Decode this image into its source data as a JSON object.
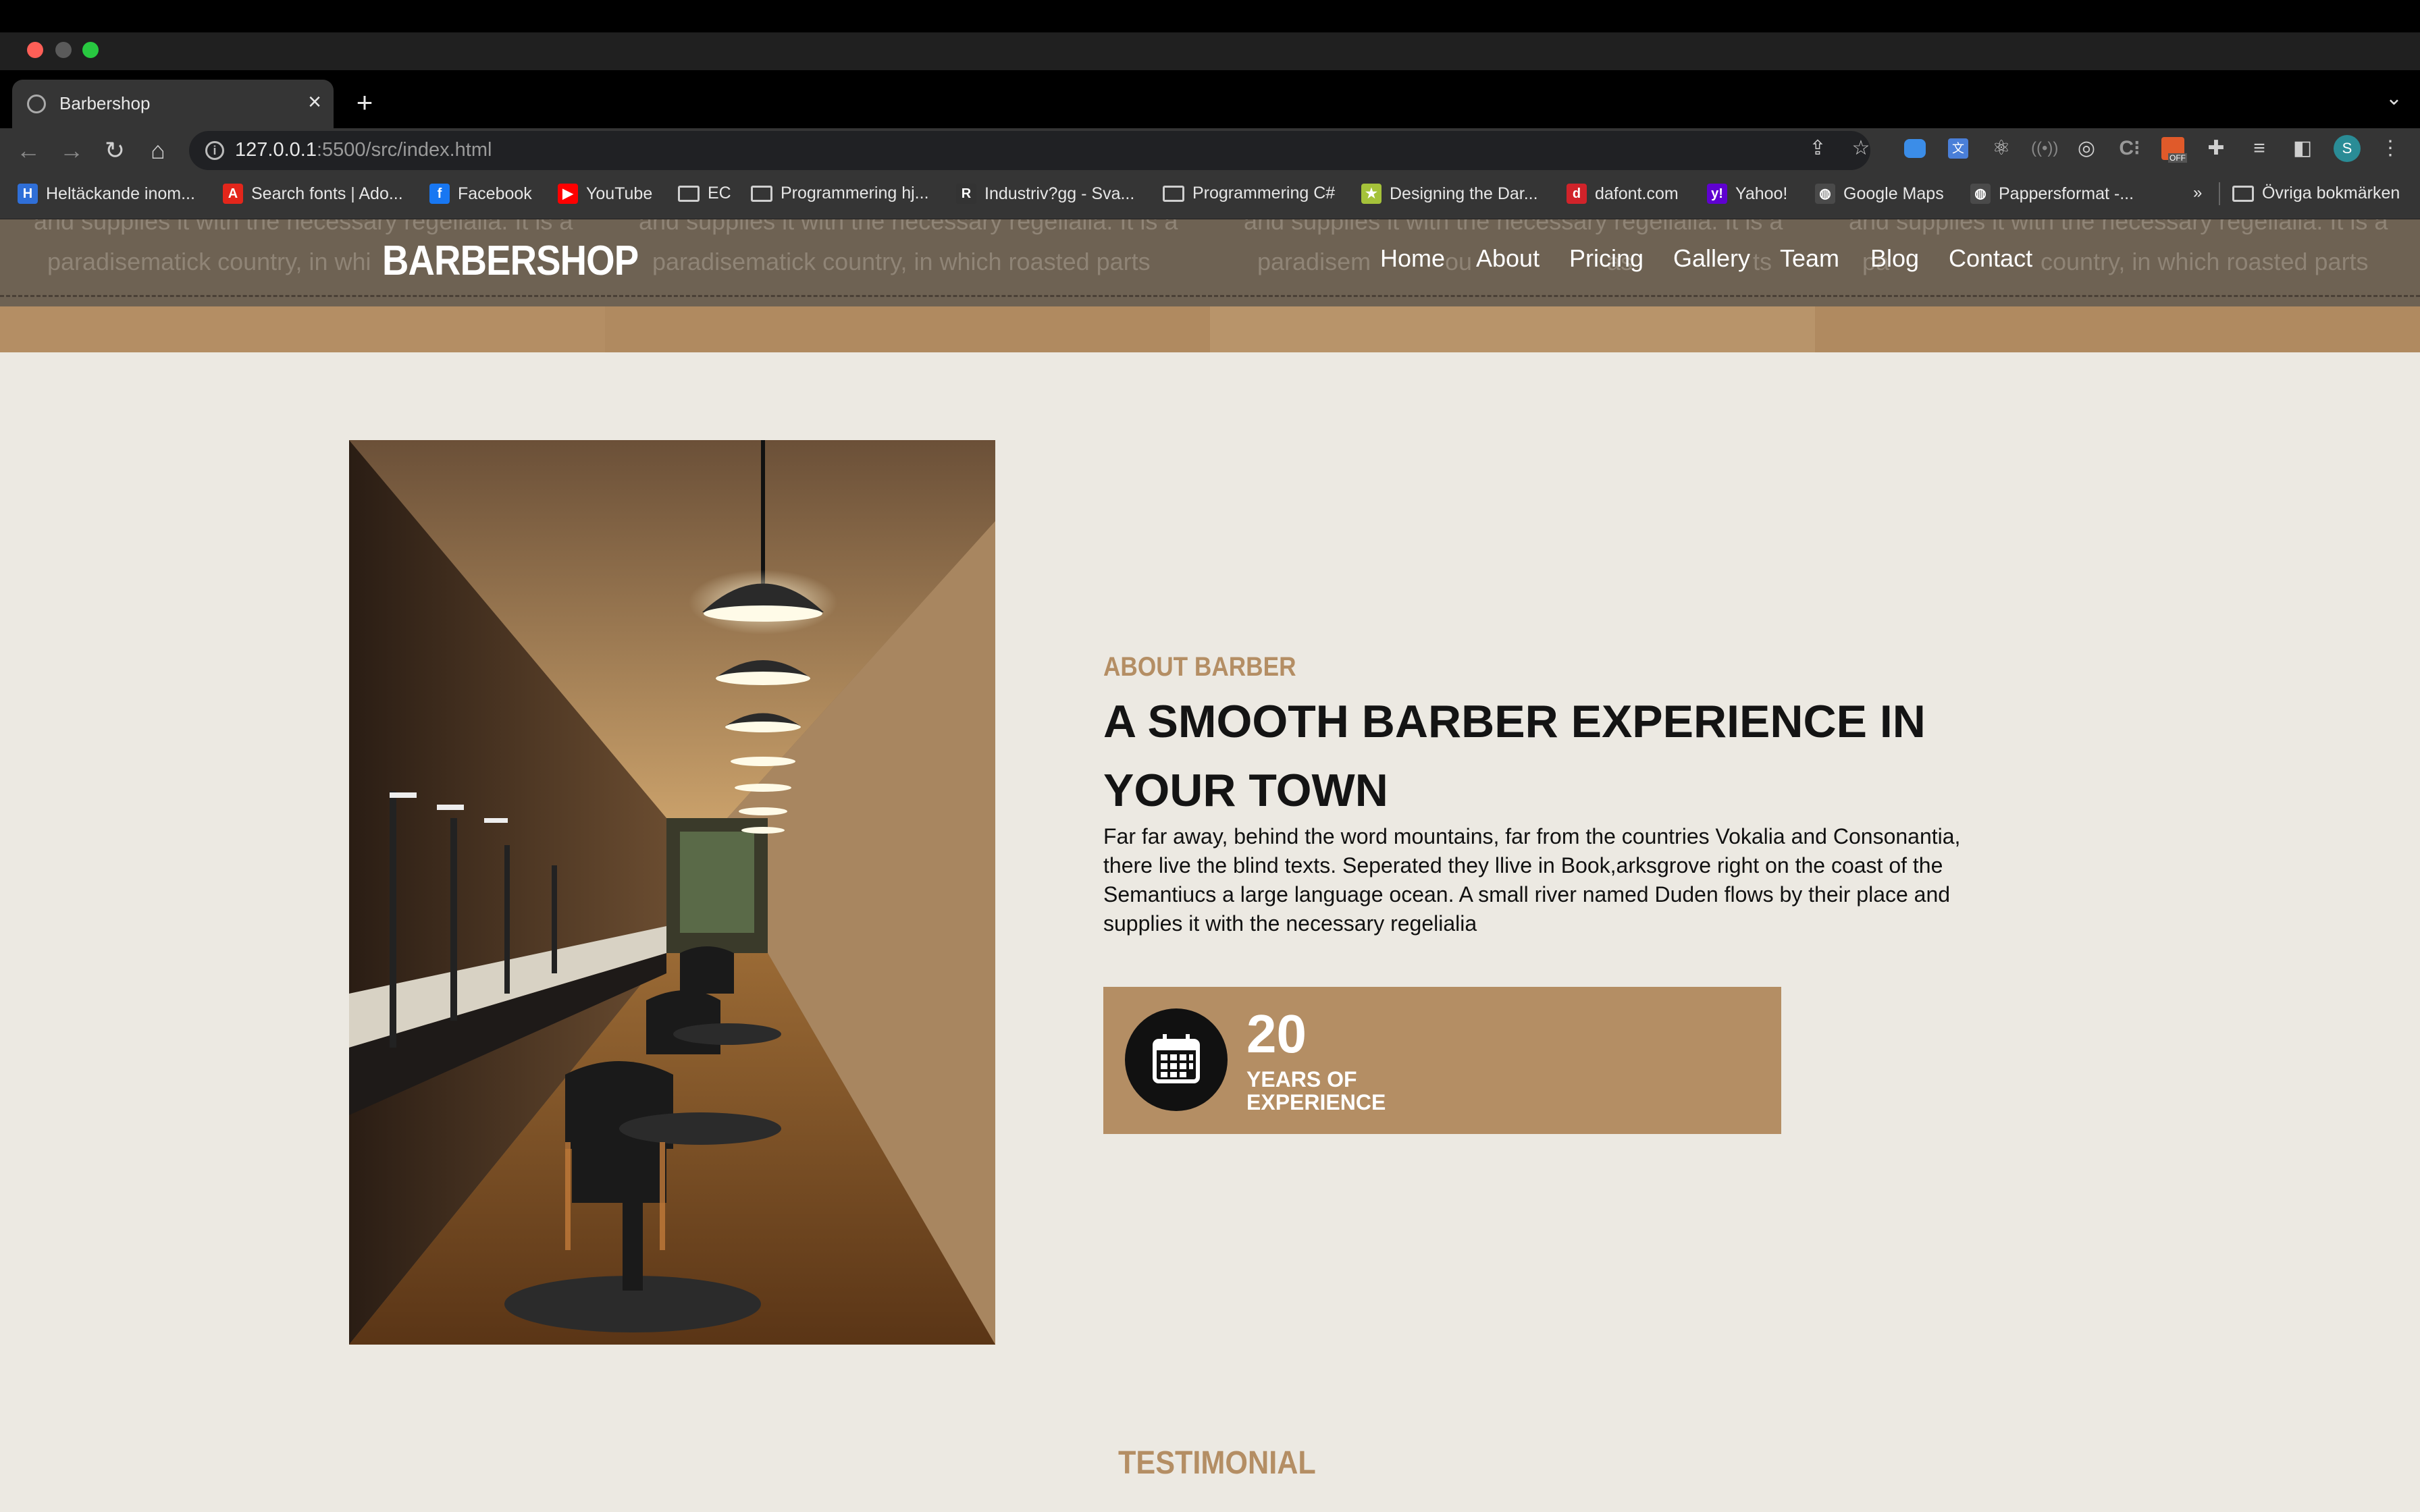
{
  "browser": {
    "tab_title": "Barbershop",
    "tab_close": "×",
    "new_tab": "+",
    "tab_menu": "⌄",
    "url_host": "127.0.0.1",
    "url_rest": ":5500/src/index.html",
    "nav": {
      "back": "←",
      "forward": "→",
      "reload": "↻",
      "home": "⌂"
    },
    "toolbar_icons": [
      "share-icon",
      "star-icon",
      "extension-cloud-icon",
      "translate-icon",
      "react-devtools-icon",
      "broadcast-icon",
      "target-icon",
      "extension-c-icon",
      "extension-off-icon",
      "puzzle-icon",
      "playlist-icon",
      "sidepanel-icon",
      "profile-avatar",
      "menu-icon"
    ],
    "profile_initial": "S",
    "off_badge": "OFF",
    "bookmarks": [
      {
        "label": "Heltäckande inom...",
        "icon": "bookmark-site-icon",
        "color": "#2f6fd8",
        "glyph": "H"
      },
      {
        "label": "Search fonts | Ado...",
        "icon": "adobe-icon",
        "color": "#e3261b",
        "glyph": "A"
      },
      {
        "label": "Facebook",
        "icon": "facebook-icon",
        "color": "#1877f2",
        "glyph": "f"
      },
      {
        "label": "YouTube",
        "icon": "youtube-icon",
        "color": "#ff0000",
        "glyph": "▶"
      },
      {
        "label": "EC",
        "icon": "folder-icon"
      },
      {
        "label": "Programmering hj...",
        "icon": "folder-icon"
      },
      {
        "label": "Industriv?gg - Sva...",
        "icon": "site-r-icon",
        "color": "#333333",
        "glyph": "R"
      },
      {
        "label": "Programmering C#",
        "icon": "folder-icon"
      },
      {
        "label": "Designing the Dar...",
        "icon": "star-badge-icon",
        "color": "#a5c23a",
        "glyph": "★"
      },
      {
        "label": "dafont.com",
        "icon": "dafont-icon",
        "color": "#d1232a",
        "glyph": "d"
      },
      {
        "label": "Yahoo!",
        "icon": "yahoo-icon",
        "color": "#5f01d1",
        "glyph": "y!"
      },
      {
        "label": "Google Maps",
        "icon": "globe-icon",
        "color": "#4a4a4a",
        "glyph": "◍"
      },
      {
        "label": "Pappersformat -...",
        "icon": "globe-icon",
        "color": "#4a4a4a",
        "glyph": "◍"
      }
    ],
    "bookmarks_overflow": "»",
    "other_bookmarks": "Övriga bokmärken"
  },
  "site": {
    "logo": "BARBERSHOP",
    "nav": [
      "Home",
      "About",
      "Pricing",
      "Gallery",
      "Team",
      "Blog",
      "Contact"
    ],
    "header_bg_text_line1": "and supplies it with the necessary regelialia. It is a",
    "header_bg_text_line2": "paradisematick country, in which roasted parts",
    "header_bg_text_fragment_1": "paradisematick country, in whi",
    "header_bg_text_fragment_2": "paradisem",
    "header_bg_text_fragment_3": "ou",
    "header_bg_text_fragment_4": "as",
    "header_bg_text_fragment_5": "ts",
    "header_bg_text_fragment_6": "pa",
    "header_bg_text_fragment_7": "country, in which roasted parts",
    "colors": {
      "accent": "#b48e64",
      "header": "#6e6253",
      "page_bg": "#ece9e2",
      "text": "#141414"
    }
  },
  "about": {
    "eyebrow": "ABOUT BARBER",
    "headline": "A SMOOTH BARBER EXPERIENCE IN YOUR TOWN",
    "paragraph": "Far far away, behind the word mountains, far from the countries Vokalia and Consonantia, there live the blind texts. Seperated they llive in Book,arksgrove right on the coast of the Semantiucs a large language ocean. A small river named Duden flows by their place and supplies it with the necessary regelialia",
    "stat": {
      "number": "20",
      "label": "YEARS OF EXPERIENCE",
      "icon": "calendar-icon"
    },
    "image": "barbershop-interior-photo"
  },
  "testimonial": {
    "heading": "TESTIMONIAL"
  }
}
